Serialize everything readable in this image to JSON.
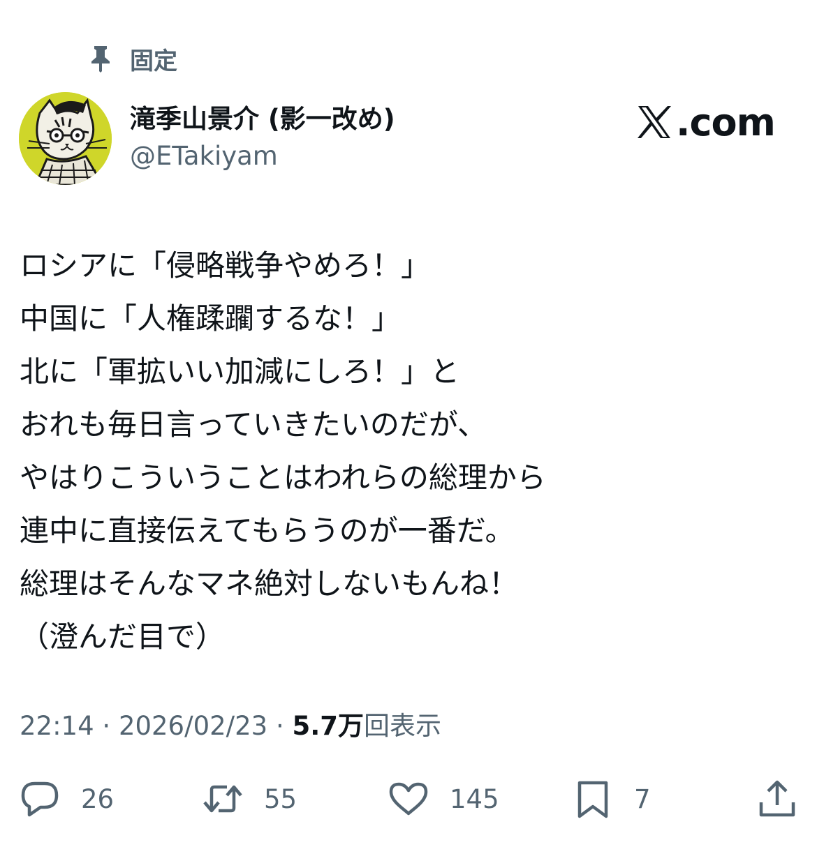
{
  "pinned": {
    "label": "固定",
    "icon": "pin-icon"
  },
  "author": {
    "display_name": "滝季山景介 (影一改め)",
    "handle": "@ETakiyam",
    "avatar_bg": "#cfd62a"
  },
  "brand": {
    "text": ".com",
    "icon": "x-logo-icon"
  },
  "tweet": {
    "lines": [
      "ロシアに「侵略戦争やめろ！」",
      "中国に「人権蹂躙するな！」",
      "北に「軍拡いい加減にしろ！」と",
      "おれも毎日言っていきたいのだが、",
      "やはりこういうことはわれらの総理から",
      "連中に直接伝えてもらうのが一番だ。",
      "総理はそんなマネ絶対しないもんね！",
      "（澄んだ目で）"
    ]
  },
  "meta": {
    "time": "22:14",
    "separator": " · ",
    "date": "2026/02/23",
    "views_count": "5.7万",
    "views_label": "回表示"
  },
  "actions": {
    "reply": {
      "icon": "reply-icon",
      "count": "26"
    },
    "repost": {
      "icon": "repost-icon",
      "count": "55"
    },
    "like": {
      "icon": "heart-icon",
      "count": "145"
    },
    "bookmark": {
      "icon": "bookmark-icon",
      "count": "7"
    },
    "share": {
      "icon": "share-icon"
    }
  },
  "colors": {
    "text": "#0f1419",
    "secondary": "#536471",
    "background": "#ffffff"
  }
}
